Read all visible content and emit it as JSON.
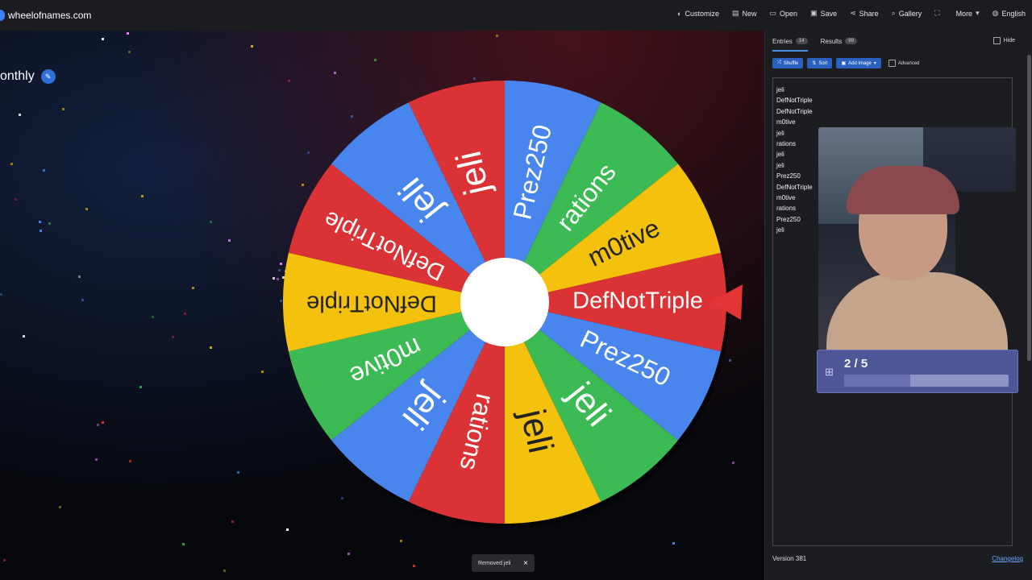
{
  "site": {
    "name": "wheelofnames.com"
  },
  "nav": [
    {
      "label": "Customize",
      "icon": "palette-icon",
      "glyph": "◐"
    },
    {
      "label": "New",
      "icon": "file-icon",
      "glyph": "▤"
    },
    {
      "label": "Open",
      "icon": "folder-icon",
      "glyph": "▭"
    },
    {
      "label": "Save",
      "icon": "save-icon",
      "glyph": "▣"
    },
    {
      "label": "Share",
      "icon": "share-icon",
      "glyph": "⋖"
    },
    {
      "label": "Gallery",
      "icon": "search-icon",
      "glyph": "⌕"
    },
    {
      "label": "",
      "icon": "fullscreen-icon",
      "glyph": "⛶"
    },
    {
      "label": "More",
      "icon": "chevron-down-icon",
      "glyph": "▾"
    },
    {
      "label": "English",
      "icon": "globe-icon",
      "glyph": "◍"
    }
  ],
  "page_title": "onthly",
  "wheel": {
    "slices": [
      {
        "label": "DefNotTriple",
        "color": "#db3236"
      },
      {
        "label": "Prez250",
        "color": "#4885ed"
      },
      {
        "label": "jeli",
        "color": "#3cba54"
      },
      {
        "label": "jeli",
        "color": "#f4c20d"
      },
      {
        "label": "rations",
        "color": "#db3236"
      },
      {
        "label": "jeli",
        "color": "#4885ed"
      },
      {
        "label": "m0tive",
        "color": "#3cba54"
      },
      {
        "label": "DefNotTriple",
        "color": "#f4c20d"
      },
      {
        "label": "DefNotTriple",
        "color": "#db3236"
      },
      {
        "label": "jeli",
        "color": "#4885ed"
      },
      {
        "label": "jeli",
        "color": "#db3236"
      },
      {
        "label": "Prez250",
        "color": "#4885ed"
      },
      {
        "label": "rations",
        "color": "#3cba54"
      },
      {
        "label": "m0tive",
        "color": "#f4c20d"
      }
    ]
  },
  "toast": {
    "text": "Removed jeli",
    "close": "×"
  },
  "panel": {
    "tabs": [
      {
        "label": "Entries",
        "count": "14"
      },
      {
        "label": "Results",
        "count": "99"
      }
    ],
    "hide_label": "Hide",
    "toolbar": {
      "shuffle": "Shuffle",
      "sort": "Sort",
      "add_image": "Add image",
      "advanced": "Advanced"
    },
    "entries": [
      "jeli",
      "DefNotTriple",
      "DefNotTriple",
      "m0tive",
      "jeli",
      "rations",
      "jeli",
      "jeli",
      "Prez250",
      "DefNotTriple",
      "m0tive",
      "rations",
      "Prez250",
      "jeli"
    ],
    "goal": {
      "text": "2 / 5",
      "progress": 0.4
    },
    "version": "Version 381",
    "changelog": "Changelog"
  }
}
